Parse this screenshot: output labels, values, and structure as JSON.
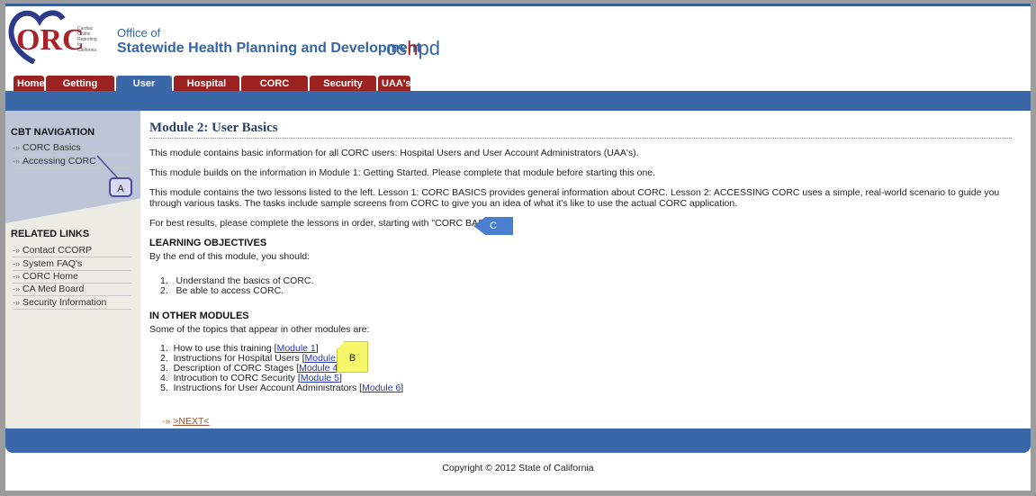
{
  "header": {
    "logo_text": "CORC",
    "logo_subtext": "Cardiac Online Reporting for California",
    "office_line1": "Office of",
    "office_line2": "Statewide Health Planning and Development",
    "oshpd_logo": "oshpd"
  },
  "tabs": [
    {
      "label": "Home"
    },
    {
      "label": "Getting Started"
    },
    {
      "label": "User Basics",
      "active": true
    },
    {
      "label": "Hospital Users"
    },
    {
      "label": "CORC Stages"
    },
    {
      "label": "Security"
    },
    {
      "label": "UAA's"
    }
  ],
  "sidebar": {
    "nav_title": "CBT NAVIGATION",
    "nav_items": [
      "CORC Basics",
      "Accessing CORC"
    ],
    "links_title": "RELATED LINKS",
    "links": [
      "Contact CCORP",
      "System FAQ's",
      "CORC Home",
      "CA Med Board",
      "Security Information"
    ]
  },
  "main": {
    "title": "Module 2: User Basics",
    "p1": "This module contains basic information for all CORC users: Hospital Users and User Account Administrators (UAA's).",
    "p2": "This module builds on the information in Module 1: Getting Started. Please complete that module before starting this one.",
    "p3": "This module contains the two lessons listed to the left. Lesson 1: CORC BASICS provides general information about CORC. Lesson 2: ACCESSING CORC uses a simple, real-world scenario to guide you through various tasks. The tasks include sample screens from CORC to give you an idea of what it's like to use the actual CORC application.",
    "p4": "For best results, please complete the lessons in order, starting with \"CORC BASICS.\"",
    "objectives_title": "LEARNING OBJECTIVES",
    "objectives_intro": "By the end of this module, you should:",
    "objectives": [
      "1.   Understand the basics of CORC.",
      "2.   Be able to access CORC."
    ],
    "other_title": "IN OTHER MODULES",
    "other_intro": "Some of the topics that appear in other modules are:",
    "other": [
      {
        "text": "1.  How to use this training ",
        "link": "Module 1"
      },
      {
        "text": "2.  Instructions for Hospital Users ",
        "link": "Module 3"
      },
      {
        "text": "3.  Description of CORC Stages ",
        "link": "Module 4"
      },
      {
        "text": "4.  Introcution to CORC Security ",
        "link": "Module 5"
      },
      {
        "text": "5.  Instructions for User Account Administrators ",
        "link": "Module 6"
      }
    ],
    "next_label": ">NEXT<"
  },
  "footer": {
    "copyright": "Copyright © 2012 State of California"
  },
  "callouts": {
    "a": "A",
    "b": "B",
    "c": "C"
  },
  "colors": {
    "brand_blue": "#3a67a8",
    "tab_red": "#9b2221"
  }
}
